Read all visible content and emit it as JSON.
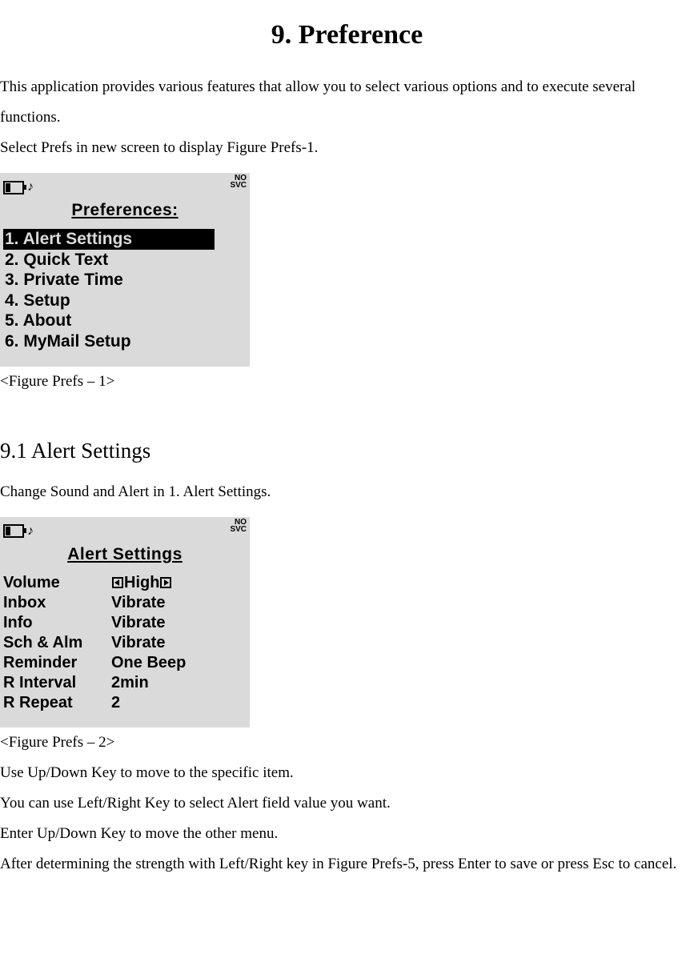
{
  "title": "9. Preference",
  "intro1": "This application provides various features that allow you to select various options and to execute several functions.",
  "intro2": "Select Prefs in new screen to display Figure Prefs-1.",
  "screen1": {
    "statusNoSvc1": "NO",
    "statusNoSvc2": "SVC",
    "title": "Preferences:",
    "items": {
      "i1": "1. Alert Settings",
      "i2": "2. Quick Text",
      "i3": "3. Private Time",
      "i4": "4. Setup",
      "i5": "5. About",
      "i6": "6. MyMail Setup"
    }
  },
  "caption1": "<Figure Prefs – 1>",
  "subTitle": "9.1 Alert Settings",
  "subIntro": "Change Sound and Alert in 1. Alert Settings.",
  "screen2": {
    "statusNoSvc1": "NO",
    "statusNoSvc2": "SVC",
    "title": "Alert Settings",
    "rows": {
      "r1l": "Volume",
      "r1v": "High",
      "r2l": "Inbox",
      "r2v": "Vibrate",
      "r3l": "Info",
      "r3v": "Vibrate",
      "r4l": "Sch & Alm",
      "r4v": "Vibrate",
      "r5l": "Reminder",
      "r5v": "One Beep",
      "r6l": "R Interval",
      "r6v": "2min",
      "r7l": "R Repeat",
      "r7v": "2"
    }
  },
  "caption2": "<Figure Prefs – 2>",
  "p1": "Use Up/Down Key to move to the specific item.",
  "p2": "You can use Left/Right Key to select Alert field value you want.",
  "p3": "Enter Up/Down Key to move the other menu.",
  "p4": "After determining the strength with Left/Right key in Figure Prefs-5, press Enter to save or press Esc to cancel."
}
